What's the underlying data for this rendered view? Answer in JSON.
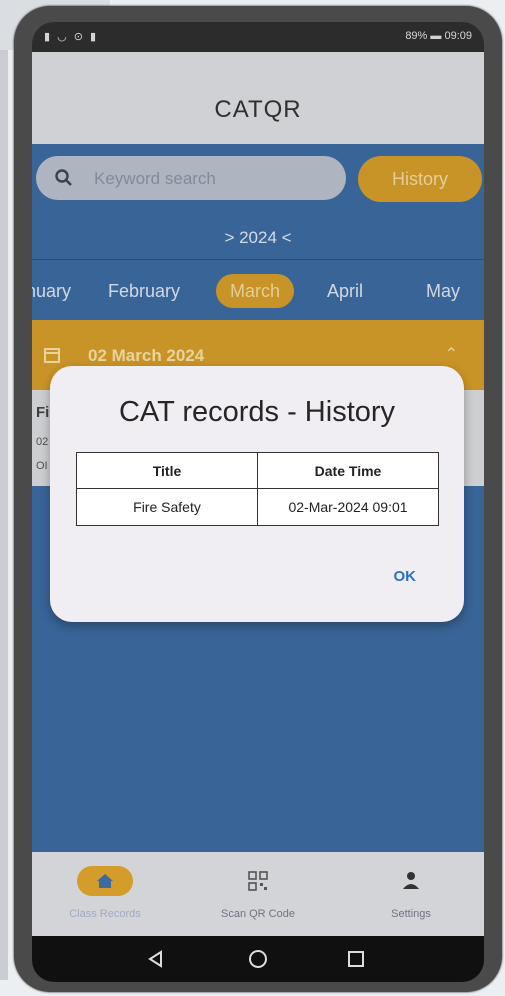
{
  "status_bar": {
    "left_icons": "▮ ◡ ⊙ ▮",
    "battery": "89%",
    "time": "09:09"
  },
  "app": {
    "title": "CATQR"
  },
  "search": {
    "placeholder": "Keyword search",
    "history_label": "History"
  },
  "year_selector": {
    "label": "> 2024 <"
  },
  "months": [
    {
      "label": "nuary",
      "active": false
    },
    {
      "label": "February",
      "active": false
    },
    {
      "label": "March",
      "active": true
    },
    {
      "label": "April",
      "active": false
    },
    {
      "label": "May",
      "active": false
    }
  ],
  "date_section": {
    "label": "02 March 2024"
  },
  "record_card": {
    "title": "Fi",
    "line1": "02",
    "line2": "OI"
  },
  "dialog": {
    "title": "CAT records - History",
    "columns": [
      "Title",
      "Date Time"
    ],
    "rows": [
      [
        "Fire Safety",
        "02-Mar-2024 09:01"
      ]
    ],
    "ok_label": "OK"
  },
  "bottom_nav": [
    {
      "label": "Class Records",
      "icon": "home-icon",
      "active": true
    },
    {
      "label": "Scan QR Code",
      "icon": "qr-code-icon",
      "active": false
    },
    {
      "label": "Settings",
      "icon": "person-icon",
      "active": false
    }
  ],
  "colors": {
    "accent": "#d49c2a",
    "primary": "#3d6aa0",
    "link": "#2a73c9"
  }
}
